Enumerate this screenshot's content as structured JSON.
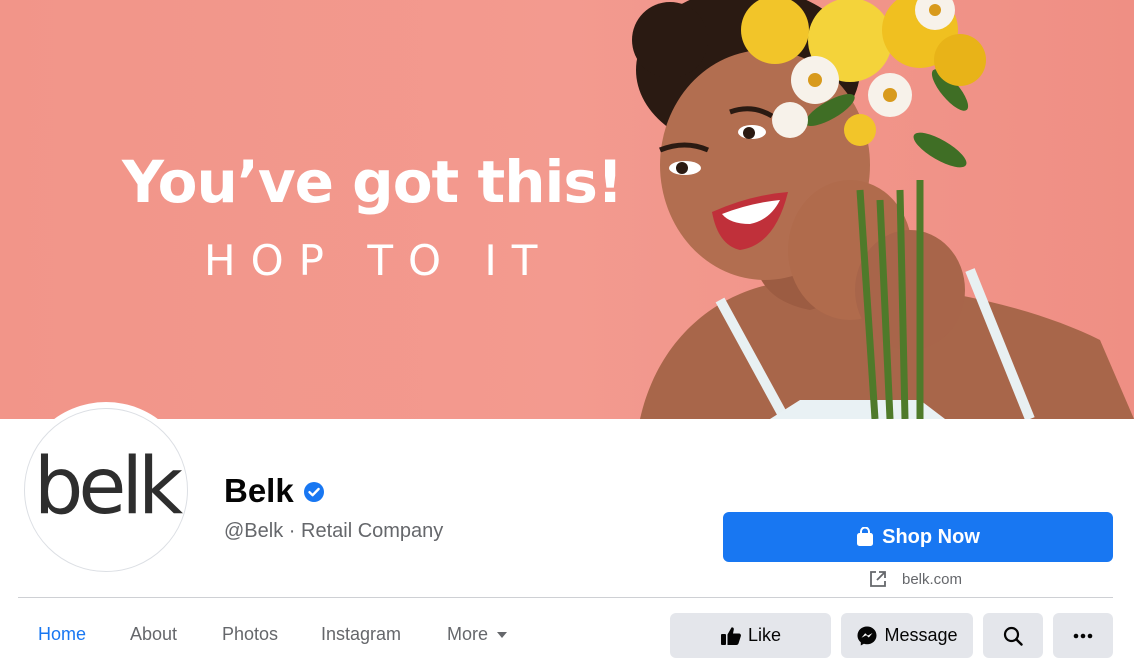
{
  "cover": {
    "headline": "You’ve got this!",
    "subline": "HOP TO IT"
  },
  "profile": {
    "logo_text": "belk",
    "name": "Belk",
    "handle": "@Belk",
    "separator": "·",
    "category": "Retail Company"
  },
  "cta": {
    "shop_label": "Shop Now",
    "website": "belk.com"
  },
  "tabs": [
    {
      "label": "Home",
      "active": true
    },
    {
      "label": "About",
      "active": false
    },
    {
      "label": "Photos",
      "active": false
    },
    {
      "label": "Instagram",
      "active": false
    },
    {
      "label": "More",
      "active": false
    }
  ],
  "actions": {
    "like_label": "Like",
    "message_label": "Message"
  },
  "colors": {
    "accent": "#1877f2",
    "cover_bg": "#f29589",
    "button_gray": "#e4e6eb"
  },
  "icons": [
    "verified-badge-icon",
    "shopping-bag-icon",
    "external-link-icon",
    "thumbs-up-icon",
    "messenger-icon",
    "search-icon",
    "more-dots-icon",
    "caret-down-icon"
  ]
}
